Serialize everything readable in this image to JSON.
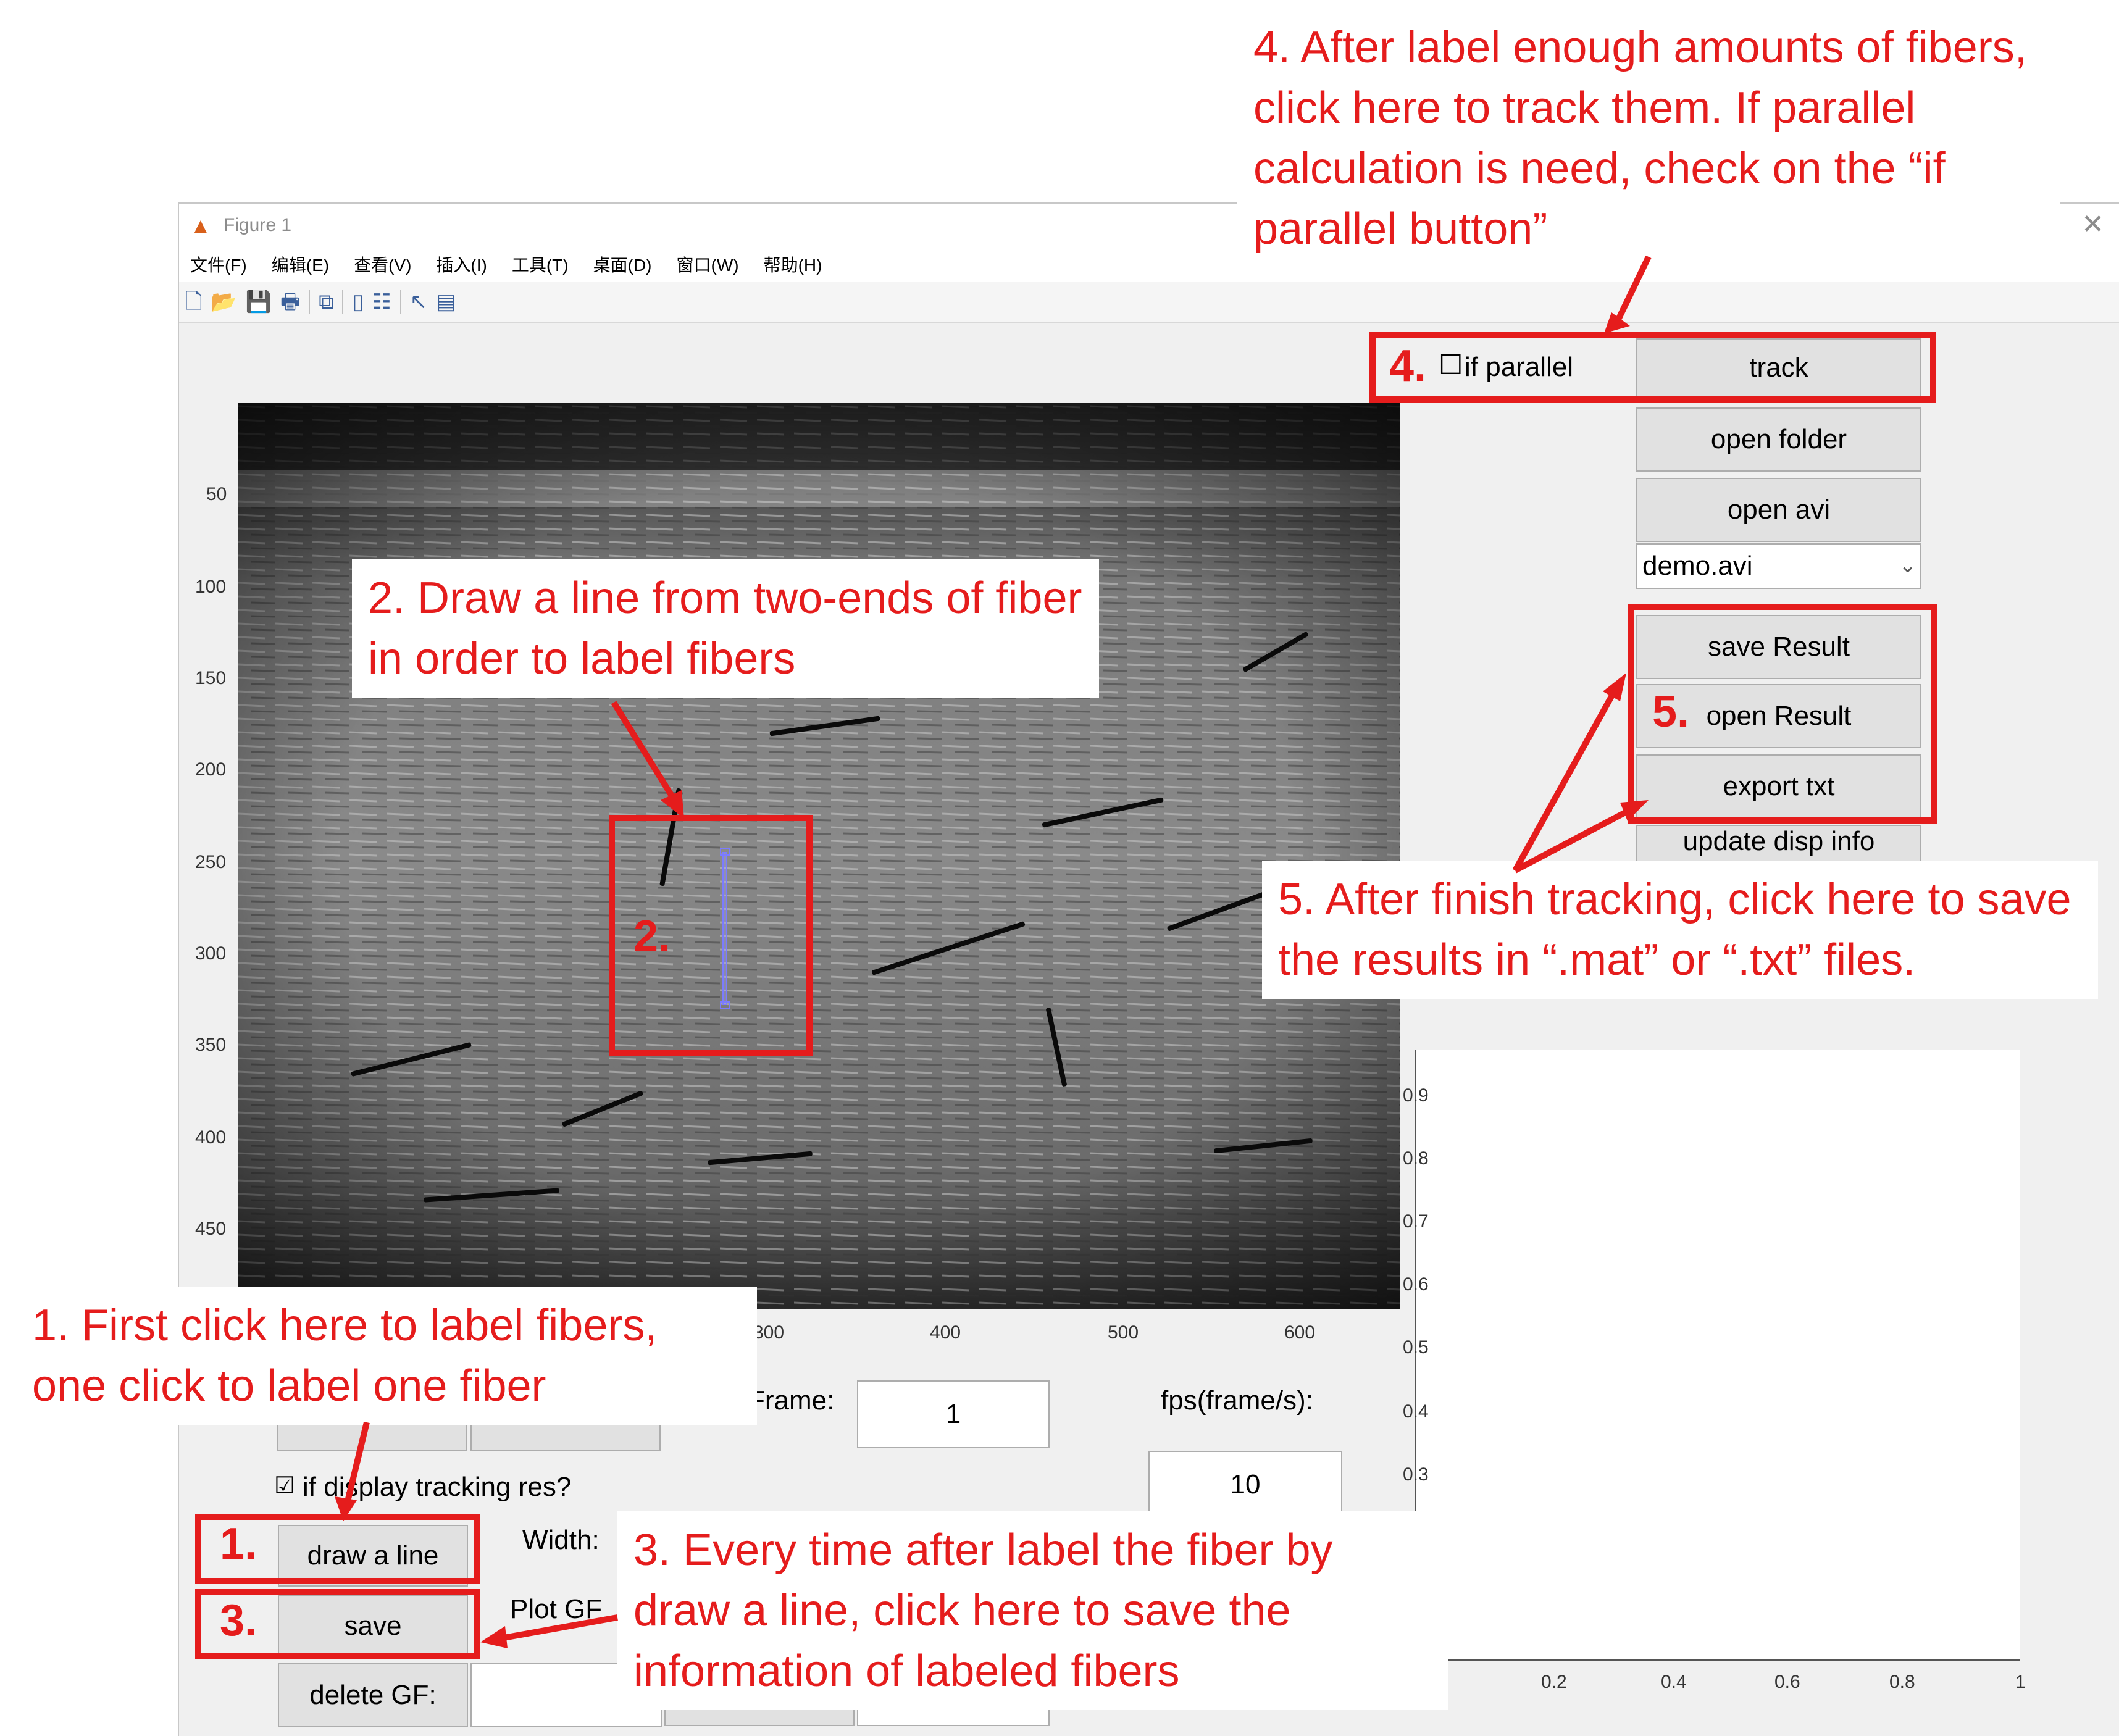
{
  "window": {
    "title": "Figure 1",
    "close": "✕",
    "menu": [
      "文件(F)",
      "编辑(E)",
      "查看(V)",
      "插入(I)",
      "工具(T)",
      "桌面(D)",
      "窗口(W)",
      "帮助(H)"
    ]
  },
  "image_axes": {
    "y_ticks": [
      "50",
      "100",
      "150",
      "200",
      "250",
      "300",
      "350",
      "400",
      "450"
    ],
    "x_ticks": [
      "300",
      "400",
      "500",
      "600"
    ]
  },
  "secondary_axes": {
    "y_ticks": [
      "0.9",
      "0.8",
      "0.7",
      "0.6",
      "0.5",
      "0.4",
      "0.3"
    ],
    "x_ticks": [
      "0.2",
      "0.4",
      "0.6",
      "0.8",
      "1"
    ]
  },
  "controls": {
    "if_parallel_label": "if parallel",
    "if_parallel_checked": false,
    "track": "track",
    "open_folder": "open folder",
    "open_avi": "open avi",
    "file_select": "demo.avi",
    "save_result": "save Result",
    "open_result": "open Result",
    "export_txt": "export txt",
    "update_disp_info": "update disp info",
    "frame_label": "Frame:",
    "frame_value": "1",
    "fps_label": "fps(frame/s):",
    "fps_value": "10",
    "if_display_label": "if display tracking res?",
    "if_display_checked": true,
    "draw_line": "draw a line",
    "width_label": "Width:",
    "save": "save",
    "plot_gf_label": "Plot GF",
    "delete_gf": "delete GF:"
  },
  "annotations": {
    "step1_num": "1.",
    "step2_num": "2.",
    "step3_num": "3.",
    "step4_num": "4.",
    "step5_num": "5.",
    "note1": "1. First click here to label fibers, one click to label one fiber",
    "note2": "2. Draw a line from two-ends of fiber in order to label fibers",
    "note3": "3. Every time after label the fiber by draw a line, click here to save the information of  labeled fibers",
    "note4": "4. After label enough amounts of fibers, click here to track them. If parallel calculation is need, check on the “if parallel button”",
    "note5": "5. After finish tracking, click here to save the results in “.mat” or “.txt” files."
  },
  "colors": {
    "annotation_red": "#e51c1c",
    "button_face": "#e1e1e1",
    "window_bg": "#f0f0f0"
  }
}
